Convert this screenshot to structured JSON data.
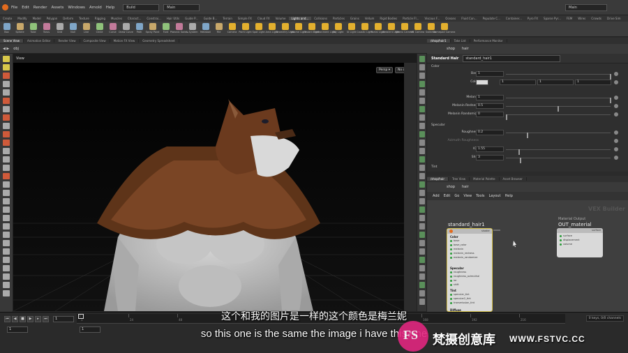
{
  "menubar": {
    "items": [
      "File",
      "Edit",
      "Render",
      "Assets",
      "Windows",
      "Arnold",
      "Help"
    ],
    "desktop": "Build",
    "context": "Main",
    "right_desktop": "Main"
  },
  "shelf_tabs": [
    "Create",
    "Modify",
    "Model",
    "Polygon",
    "Deform",
    "Texture",
    "Rigging",
    "Muscles",
    "Charact...",
    "Constrai...",
    "Hair Utils",
    "Guide P...",
    "Guide B...",
    "Terrain",
    "Simple FX",
    "Cloud FX",
    "Volume",
    "Lights and...",
    "Collisions",
    "Particles",
    "Grains",
    "Vellum",
    "Rigid Bodies",
    "Particle Fl...",
    "Viscous F...",
    "Oceans",
    "Fluid Con...",
    "Populate C...",
    "Container...",
    "Pyro FX",
    "Sparse Pyr...",
    "FEM",
    "Wires",
    "Crowds",
    "Drive Sim"
  ],
  "shelf_tools": [
    "Box",
    "Sphere",
    "Tube",
    "Torus",
    "Grid",
    "Null",
    "Line",
    "Circle",
    "Curve",
    "Draw Curve",
    "Path",
    "Spray Paint",
    "Font",
    "Platonic Solids",
    "L-System",
    "Metaball",
    "File",
    "Camera",
    "Point Light",
    "Spot Light",
    "Area Light",
    "Geometry Light",
    "Volume Light",
    "Distant Light",
    "Environment Light",
    "Sky Light",
    "GI Light",
    "Caustic Light",
    "Portal Light",
    "Ambient Light",
    "Stereo Camera",
    "VR Camera",
    "Switcher",
    "Gamepad Camera"
  ],
  "left_tabs": [
    "Scene View",
    "Animation Editor",
    "Render View",
    "Composite View",
    "Motion FX View",
    "Geometry Spreadsheet"
  ],
  "left_path": "obj",
  "viewport": {
    "title": "View",
    "persp": "Persp ▾",
    "cam": "No cam ▾"
  },
  "right_tabs": [
    "/shop/hair1",
    "Take List",
    "Performance Monitor"
  ],
  "right_path": [
    "shop",
    "hair"
  ],
  "params": {
    "node_type": "Standard Hair",
    "node_name": "standard_hair1",
    "section_color": "Color",
    "section_specular": "Specular",
    "section_tint": "Tint",
    "base_label": "Base",
    "base_value": "1",
    "color_label": "Color",
    "color_r": "1",
    "color_g": "1",
    "color_b": "1",
    "melanin_label": "Melanin",
    "melanin_value": "1",
    "redness_label": "Melanin Redness",
    "redness_value": "0.5",
    "random_label": "Melanin Randomize",
    "random_value": "0",
    "rough_label": "Roughness",
    "rough_value": "0.2",
    "aniso_label": "Azimuth Roughness",
    "ior_label": "IOR",
    "ior_value": "1.55",
    "shift_label": "Shift",
    "shift_value": "3"
  },
  "network": {
    "tabs": [
      "/shop/hair",
      "Tree View",
      "Material Palette",
      "Asset Browser"
    ],
    "path": [
      "shop",
      "hair"
    ],
    "menu": [
      "Add",
      "Edit",
      "Go",
      "View",
      "Tools",
      "Layout",
      "Help"
    ],
    "context_label": "VEX Builder",
    "node1_title": "standard_hair1",
    "node1_sections": {
      "color": "Color",
      "specular": "Specular",
      "tint": "Tint",
      "diffuse": "Diffuse"
    },
    "node1_color_ports": [
      "base",
      "base_color",
      "melanin",
      "melanin_redness",
      "melanin_randomize"
    ],
    "node1_spec_ports": [
      "roughness",
      "roughness_azimuthal",
      "ior",
      "shift"
    ],
    "node1_tint_ports": [
      "specular_tint",
      "specular2_tint",
      "transmission_tint"
    ],
    "node1_output": "shader",
    "node2_sub": "Material Output",
    "node2_title": "OUT_material",
    "node2_ports": [
      "surface",
      "displacement",
      "volume"
    ],
    "node2_output": "surface"
  },
  "timeline": {
    "frame": "1",
    "start": "1",
    "end": "1",
    "ticks": [
      "1",
      "24",
      "48",
      "72",
      "96",
      "120",
      "144",
      "168",
      "192",
      "216"
    ],
    "keys": "0 keys, 0/0 channels"
  },
  "subtitles": {
    "cn": "这个和我的图片是一样的这个颜色是梅兰妮",
    "en": "so this one is the same the image i have this one"
  },
  "watermark": {
    "logo": "FS",
    "cn": "梵摄创意库",
    "url": "WWW.FSTVC.CC"
  },
  "colors": {
    "houdini_orange": "#e36b1e",
    "fur": "#6b3a1e",
    "node_green": "#2b9c3a",
    "watermark_pink": "#e0267f"
  }
}
